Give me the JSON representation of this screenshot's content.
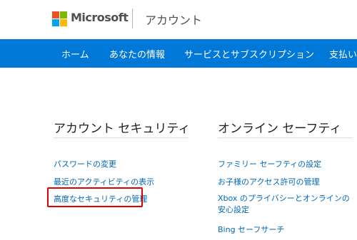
{
  "header": {
    "brand": "Microsoft",
    "section": "アカウント",
    "logo_colors": [
      "#f25022",
      "#7fba00",
      "#00a4ef",
      "#ffb900"
    ]
  },
  "nav": {
    "background": "#0078d7",
    "items": [
      "ホーム",
      "あなたの情報",
      "サービスとサブスクリプション",
      "支払い"
    ]
  },
  "account_security": {
    "title": "アカウント セキュリティ",
    "links": [
      "パスワードの変更",
      "最近のアクティビティの表示",
      "高度なセキュリティの管理"
    ]
  },
  "online_safety": {
    "title": "オンライン セーフティ",
    "links": [
      "ファミリー セーフティの設定",
      "お子様のアクセス許可の管理",
      "Xbox のプライバシーとオンラインの安心設定",
      "Bing セーフサーチ"
    ]
  },
  "highlight_color": "#e00000"
}
